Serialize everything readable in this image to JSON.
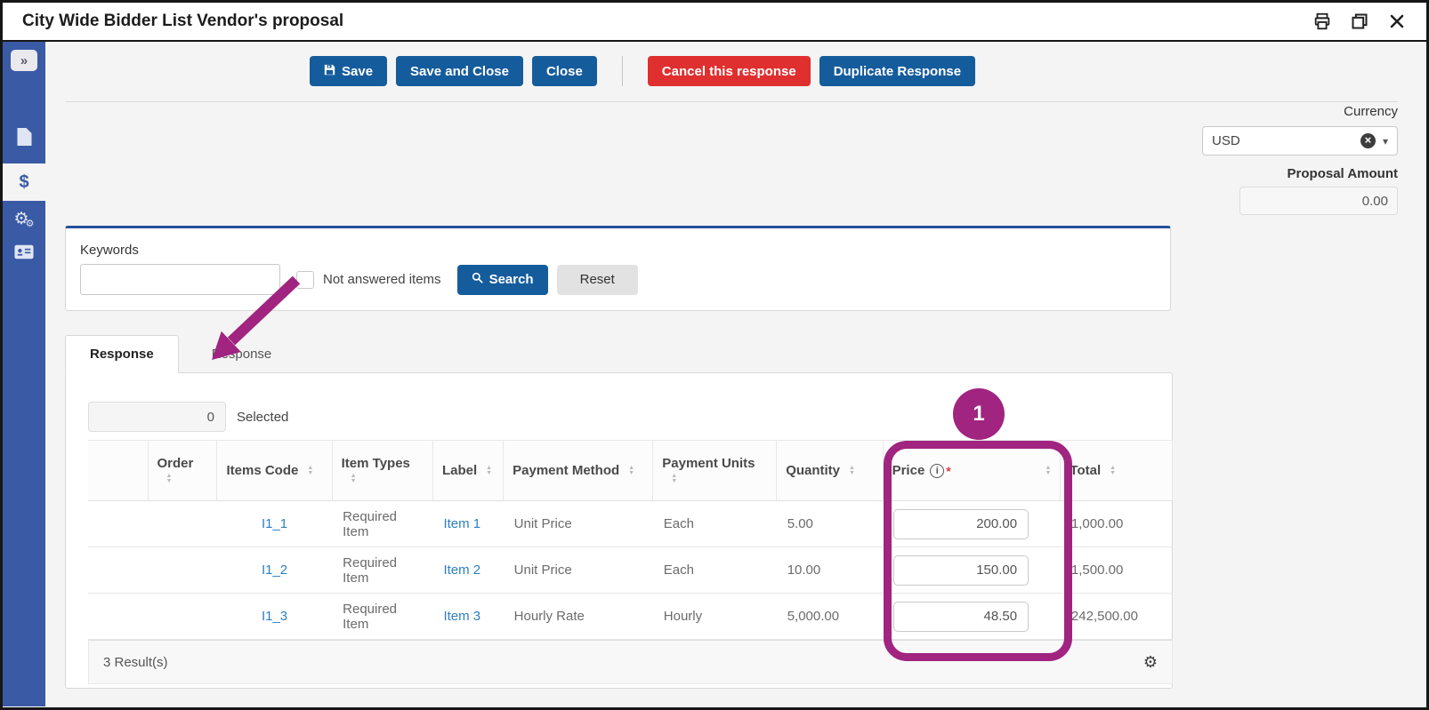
{
  "colors": {
    "sidebar_blue": "#3a5aa5",
    "button_blue": "#155c9c",
    "danger_red": "#df2f2f",
    "highlight_magenta": "#a02480",
    "link_blue": "#2d7fc3",
    "panel_accent_blue": "#24509b"
  },
  "icons": {
    "collapse": "»",
    "caret_down": "▾",
    "sort_asc": "▲",
    "sort_desc": "▼",
    "gear": "⚙",
    "clear": "×",
    "info": "i",
    "required": "*",
    "dollar": "$"
  },
  "window": {
    "title": "City Wide Bidder List Vendor's proposal"
  },
  "toolbar": {
    "save": "Save",
    "save_and_close": "Save and Close",
    "close": "Close",
    "cancel": "Cancel this response",
    "duplicate": "Duplicate Response"
  },
  "currency": {
    "label": "Currency",
    "value": "USD"
  },
  "proposal": {
    "label": "Proposal Amount",
    "value": "0.00"
  },
  "search": {
    "keywords_label": "Keywords",
    "keywords_value": "",
    "not_answered": "Not answered items",
    "search": "Search",
    "reset": "Reset"
  },
  "tabs": {
    "active": "Response",
    "inactive": "Response"
  },
  "selection": {
    "count": "0",
    "label": "Selected"
  },
  "table": {
    "headers": {
      "order": "Order",
      "items_code": "Items Code",
      "item_types": "Item Types",
      "label": "Label",
      "payment_method": "Payment Method",
      "payment_units": "Payment Units",
      "quantity": "Quantity",
      "price": "Price",
      "total": "Total"
    },
    "rows": [
      {
        "items_code": "I1_1",
        "item_type": "Required Item",
        "label": "Item 1",
        "payment_method": "Unit Price",
        "payment_units": "Each",
        "quantity": "5.00",
        "price": "200.00",
        "total": "1,000.00"
      },
      {
        "items_code": "I1_2",
        "item_type": "Required Item",
        "label": "Item 2",
        "payment_method": "Unit Price",
        "payment_units": "Each",
        "quantity": "10.00",
        "price": "150.00",
        "total": "1,500.00"
      },
      {
        "items_code": "I1_3",
        "item_type": "Required Item",
        "label": "Item 3",
        "payment_method": "Hourly Rate",
        "payment_units": "Hourly",
        "quantity": "5,000.00",
        "price": "48.50",
        "total": "242,500.00"
      }
    ],
    "results": "3 Result(s)"
  },
  "annotations": {
    "step": "1"
  }
}
